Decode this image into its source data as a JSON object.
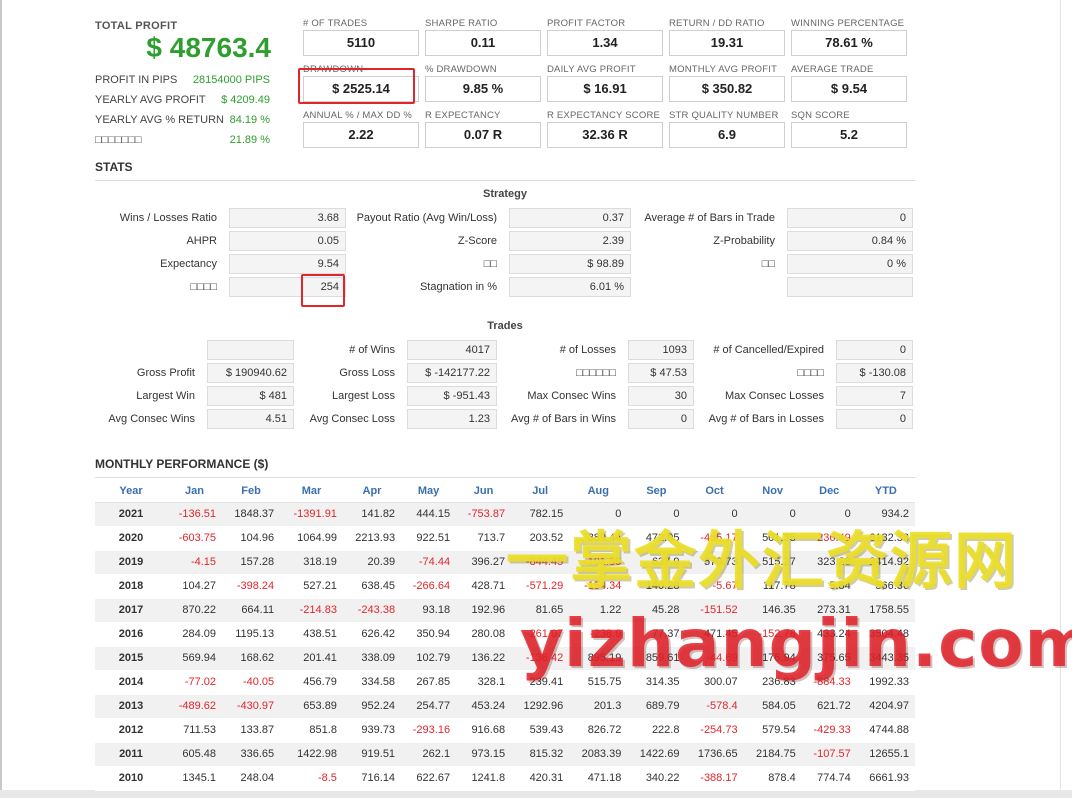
{
  "summary": {
    "total_label": "TOTAL PROFIT",
    "total_value": "$ 48763.4",
    "rows": [
      {
        "label": "PROFIT IN PIPS",
        "value": "28154000 PIPS"
      },
      {
        "label": "YEARLY AVG PROFIT",
        "value": "$ 4209.49"
      },
      {
        "label": "YEARLY AVG % RETURN",
        "value": "84.19 %"
      },
      {
        "label": "□□□□□□□",
        "value": "21.89 %"
      }
    ]
  },
  "metrics": [
    {
      "label": "# OF TRADES",
      "value": "5110"
    },
    {
      "label": "SHARPE RATIO",
      "value": "0.11"
    },
    {
      "label": "PROFIT FACTOR",
      "value": "1.34"
    },
    {
      "label": "RETURN / DD RATIO",
      "value": "19.31"
    },
    {
      "label": "WINNING PERCENTAGE",
      "value": "78.61 %"
    },
    {
      "label": "DRAWDOWN",
      "value": "$ 2525.14"
    },
    {
      "label": "% DRAWDOWN",
      "value": "9.85 %"
    },
    {
      "label": "DAILY AVG PROFIT",
      "value": "$ 16.91"
    },
    {
      "label": "MONTHLY AVG PROFIT",
      "value": "$ 350.82"
    },
    {
      "label": "AVERAGE TRADE",
      "value": "$ 9.54"
    },
    {
      "label": "ANNUAL % / MAX DD %",
      "value": "2.22"
    },
    {
      "label": "R EXPECTANCY",
      "value": "0.07 R"
    },
    {
      "label": "R EXPECTANCY SCORE",
      "value": "32.36 R"
    },
    {
      "label": "STR QUALITY NUMBER",
      "value": "6.9"
    },
    {
      "label": "SQN SCORE",
      "value": "5.2"
    }
  ],
  "stats": {
    "title": "STATS",
    "strategy_title": "Strategy",
    "strategy": [
      {
        "label": "Wins / Losses Ratio",
        "value": "3.68"
      },
      {
        "label": "Payout Ratio (Avg Win/Loss)",
        "value": "0.37"
      },
      {
        "label": "Average # of Bars in Trade",
        "value": "0"
      },
      {
        "label": "AHPR",
        "value": "0.05"
      },
      {
        "label": "Z-Score",
        "value": "2.39"
      },
      {
        "label": "Z-Probability",
        "value": "0.84 %"
      },
      {
        "label": "Expectancy",
        "value": "9.54"
      },
      {
        "label": "□□",
        "value": "$ 98.89"
      },
      {
        "label": "□□",
        "value": "0 %"
      },
      {
        "label": "□□□□",
        "value": "254"
      },
      {
        "label": "Stagnation in %",
        "value": "6.01 %"
      },
      {
        "label": "",
        "value": ""
      }
    ],
    "trades_title": "Trades",
    "trades": [
      {
        "label": "",
        "value": ""
      },
      {
        "label": "# of Wins",
        "value": "4017"
      },
      {
        "label": "# of Losses",
        "value": "1093"
      },
      {
        "label": "# of Cancelled/Expired",
        "value": "0"
      },
      {
        "label": "Gross Profit",
        "value": "$ 190940.62"
      },
      {
        "label": "Gross Loss",
        "value": "$ -142177.22"
      },
      {
        "label": "□□□□□□",
        "value": "$ 47.53"
      },
      {
        "label": "□□□□",
        "value": "$ -130.08"
      },
      {
        "label": "Largest Win",
        "value": "$ 481"
      },
      {
        "label": "Largest Loss",
        "value": "$ -951.43"
      },
      {
        "label": "Max Consec Wins",
        "value": "30"
      },
      {
        "label": "Max Consec Losses",
        "value": "7"
      },
      {
        "label": "Avg Consec Wins",
        "value": "4.51"
      },
      {
        "label": "Avg Consec Loss",
        "value": "1.23"
      },
      {
        "label": "Avg # of Bars in Wins",
        "value": "0"
      },
      {
        "label": "Avg # of Bars in Losses",
        "value": "0"
      }
    ]
  },
  "monthly": {
    "title": "MONTHLY PERFORMANCE ($)",
    "headers": [
      "Year",
      "Jan",
      "Feb",
      "Mar",
      "Apr",
      "May",
      "Jun",
      "Jul",
      "Aug",
      "Sep",
      "Oct",
      "Nov",
      "Dec",
      "YTD"
    ],
    "rows": [
      [
        "2021",
        "-136.51",
        "1848.37",
        "-1391.91",
        "141.82",
        "444.15",
        "-753.87",
        "782.15",
        "0",
        "0",
        "0",
        "0",
        "0",
        "934.2"
      ],
      [
        "2020",
        "-603.75",
        "104.96",
        "1064.99",
        "2213.93",
        "922.51",
        "713.7",
        "203.52",
        "389.44",
        "472.95",
        "-485.17",
        "501.35",
        "-236.49",
        "6182.33"
      ],
      [
        "2019",
        "-4.15",
        "157.28",
        "318.19",
        "20.39",
        "-74.44",
        "396.27",
        "-844.45",
        "-101.39",
        "637.9",
        "570.73",
        "515.27",
        "323.28",
        "2414.92"
      ],
      [
        "2018",
        "104.27",
        "-398.24",
        "527.21",
        "638.45",
        "-266.64",
        "428.71",
        "-571.29",
        "-154.34",
        "140.28",
        "-5.67",
        "117.78",
        "5.84",
        "566.36"
      ],
      [
        "2017",
        "870.22",
        "664.11",
        "-214.83",
        "-243.38",
        "93.18",
        "192.96",
        "81.65",
        "1.22",
        "45.28",
        "-151.52",
        "146.35",
        "273.31",
        "1758.55"
      ],
      [
        "2016",
        "284.09",
        "1195.13",
        "438.51",
        "626.42",
        "350.94",
        "280.08",
        "-261.07",
        "-238.9",
        "77.37",
        "471.45",
        "-152.78",
        "433.24",
        "3504.48"
      ],
      [
        "2015",
        "569.94",
        "168.62",
        "201.41",
        "338.09",
        "102.79",
        "136.22",
        "-136.42",
        "895.19",
        "859.61",
        "-44.69",
        "176.94",
        "375.65",
        "3443.35"
      ],
      [
        "2014",
        "-77.02",
        "-40.05",
        "456.79",
        "334.58",
        "267.85",
        "328.1",
        "239.41",
        "515.75",
        "314.35",
        "300.07",
        "236.83",
        "-884.33",
        "1992.33"
      ],
      [
        "2013",
        "-489.62",
        "-430.97",
        "653.89",
        "952.24",
        "254.77",
        "453.24",
        "1292.96",
        "201.3",
        "689.79",
        "-578.4",
        "584.05",
        "621.72",
        "4204.97"
      ],
      [
        "2012",
        "711.53",
        "133.87",
        "851.8",
        "939.73",
        "-293.16",
        "916.68",
        "539.43",
        "826.72",
        "222.8",
        "-254.73",
        "579.54",
        "-429.33",
        "4744.88"
      ],
      [
        "2011",
        "605.48",
        "336.65",
        "1422.98",
        "919.51",
        "262.1",
        "973.15",
        "815.32",
        "2083.39",
        "1422.69",
        "1736.65",
        "2184.75",
        "-107.57",
        "12655.1"
      ],
      [
        "2010",
        "1345.1",
        "248.04",
        "-8.5",
        "716.14",
        "622.67",
        "1241.8",
        "420.31",
        "471.18",
        "340.22",
        "-388.17",
        "878.4",
        "774.74",
        "6661.93"
      ]
    ]
  },
  "watermark": {
    "line1": "一掌金外汇资源网",
    "line2": "yizhangjin.com"
  },
  "colors": {
    "profit_green": "#2e9e2e",
    "negative_red": "#e0262b",
    "header_blue": "#3a6fb0",
    "highlight_box_red": "#e0262b"
  }
}
